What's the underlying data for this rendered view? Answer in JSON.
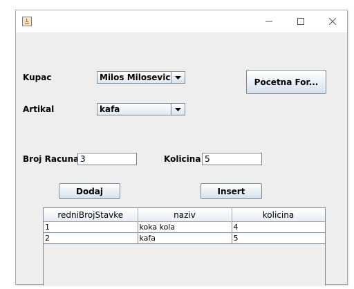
{
  "window": {
    "title": "",
    "controls": {
      "minimize": "minimize-icon",
      "maximize": "maximize-icon",
      "close": "close-icon"
    }
  },
  "form": {
    "kupac_label": "Kupac",
    "kupac_value": "Milos Milosevic",
    "artikal_label": "Artikal",
    "artikal_value": "kafa",
    "pocetna_button": "Pocetna For...",
    "broj_racuna_label": "Broj Racuna",
    "broj_racuna_value": "3",
    "kolicina_label": "Kolicina",
    "kolicina_value": "5",
    "dodaj_button": "Dodaj",
    "insert_button": "Insert"
  },
  "table": {
    "columns": [
      "redniBrojStavke",
      "naziv",
      "kolicina"
    ],
    "rows": [
      [
        "1",
        "koka kola",
        "4"
      ],
      [
        "2",
        "kafa",
        "5"
      ]
    ]
  }
}
